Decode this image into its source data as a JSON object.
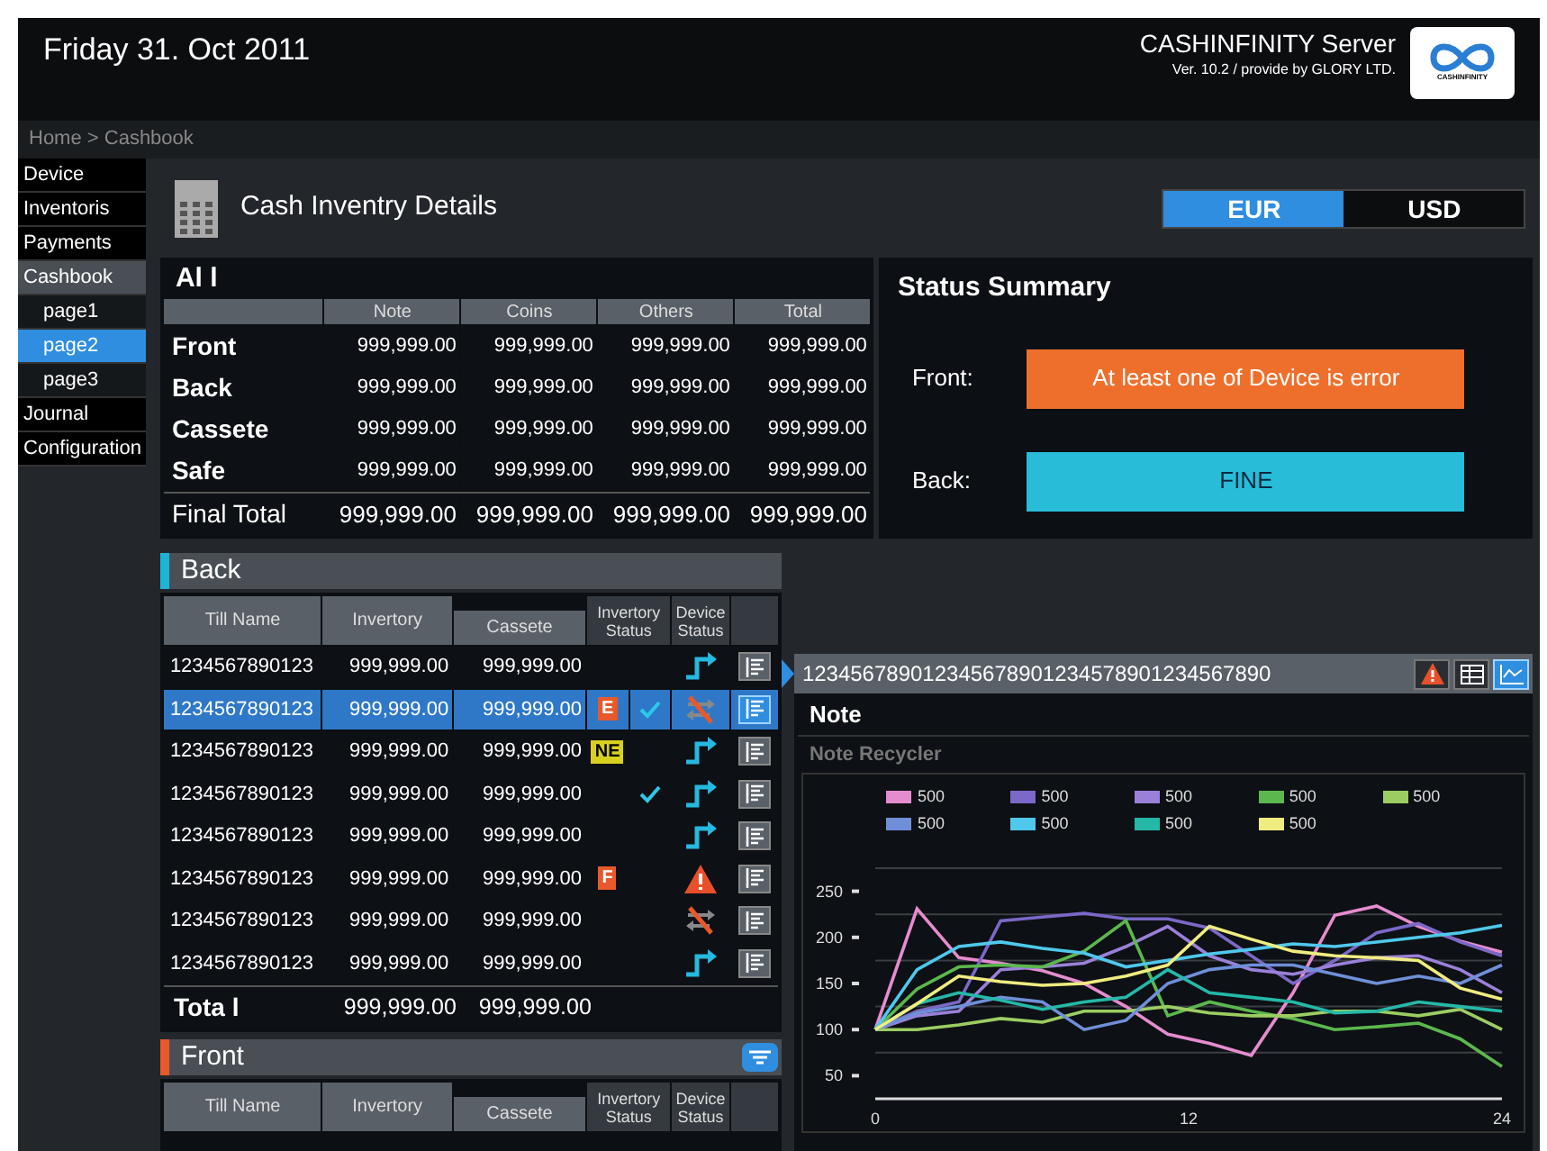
{
  "header": {
    "date": "Friday 31. Oct 2011",
    "product": "CASHINFINITY Server",
    "version": "Ver. 10.2 / provide by GLORY LTD.",
    "logo_text": "CASHINFINITY"
  },
  "breadcrumb": "Home > Cashbook",
  "sidebar": {
    "items": [
      {
        "label": "Device",
        "selected": false
      },
      {
        "label": "Inventoris",
        "selected": false
      },
      {
        "label": "Payments",
        "selected": false
      },
      {
        "label": "Cashbook",
        "selected": false,
        "expanded": true,
        "children": [
          {
            "label": "page1",
            "selected": false
          },
          {
            "label": "page2",
            "selected": true
          },
          {
            "label": "page3",
            "selected": false
          }
        ]
      },
      {
        "label": "Journal",
        "selected": false
      },
      {
        "label": "Configuration",
        "selected": false
      }
    ]
  },
  "page_title": "Cash Inventry Details",
  "currency_tabs": [
    {
      "label": "EUR",
      "selected": true
    },
    {
      "label": "USD",
      "selected": false
    }
  ],
  "all_table": {
    "title": "Al l",
    "columns": [
      "Note",
      "Coins",
      "Others",
      "Total"
    ],
    "rows": [
      {
        "label": "Front",
        "cells": [
          "999,999.00",
          "999,999.00",
          "999,999.00",
          "999,999.00"
        ]
      },
      {
        "label": "Back",
        "cells": [
          "999,999.00",
          "999,999.00",
          "999,999.00",
          "999,999.00"
        ]
      },
      {
        "label": "Cassete",
        "cells": [
          "999,999.00",
          "999,999.00",
          "999,999.00",
          "999,999.00"
        ]
      },
      {
        "label": "Safe",
        "cells": [
          "999,999.00",
          "999,999.00",
          "999,999.00",
          "999,999.00"
        ]
      }
    ],
    "total": {
      "label": "Final Total",
      "cells": [
        "999,999.00",
        "999,999.00",
        "999,999.00",
        "999,999.00"
      ]
    }
  },
  "status_summary": {
    "title": "Status Summary",
    "items": [
      {
        "label": "Front:",
        "status": "At least one of Device is error",
        "kind": "error"
      },
      {
        "label": "Back:",
        "status": "FINE",
        "kind": "fine"
      }
    ]
  },
  "back_table": {
    "title": "Back",
    "color": "#1eb4d8",
    "columns": [
      "Till Name",
      "Invertory",
      "Cassete",
      "Invertory Status",
      "Device Status"
    ],
    "rows": [
      {
        "till": "1234567890123",
        "inventory": "999,999.00",
        "cassete": "999,999.00",
        "checked": false,
        "kind": "connected",
        "selected": false
      },
      {
        "till": "1234567890123",
        "inventory": "999,999.00",
        "cassete": "999,999.00",
        "badge": "E",
        "checked": true,
        "kind": "disconnected",
        "selected": true
      },
      {
        "till": "1234567890123",
        "inventory": "999,999.00",
        "cassete": "999,999.00",
        "badge": "NE",
        "checked": false,
        "kind": "connected",
        "selected": false
      },
      {
        "till": "1234567890123",
        "inventory": "999,999.00",
        "cassete": "999,999.00",
        "checked": true,
        "kind": "connected",
        "selected": false
      },
      {
        "till": "1234567890123",
        "inventory": "999,999.00",
        "cassete": "999,999.00",
        "checked": false,
        "kind": "connected",
        "selected": false
      },
      {
        "till": "1234567890123",
        "inventory": "999,999.00",
        "cassete": "999,999.00",
        "badge": "F",
        "checked": false,
        "kind": "warning",
        "selected": false
      },
      {
        "till": "1234567890123",
        "inventory": "999,999.00",
        "cassete": "999,999.00",
        "checked": false,
        "kind": "disconnected",
        "selected": false
      },
      {
        "till": "1234567890123",
        "inventory": "999,999.00",
        "cassete": "999,999.00",
        "checked": false,
        "kind": "connected",
        "selected": false
      }
    ],
    "total": {
      "label": "Tota l",
      "inventory": "999,999.00",
      "cassete": "999,999.00"
    }
  },
  "front_table": {
    "title": "Front",
    "color": "#e8582a",
    "columns": [
      "Till Name",
      "Invertory",
      "Cassete",
      "Invertory Status",
      "Device Status"
    ]
  },
  "detail": {
    "id": "123456789012345678901234578901234567890",
    "view_buttons": [
      {
        "kind": "warning",
        "selected": false
      },
      {
        "kind": "table",
        "selected": false
      },
      {
        "kind": "chart",
        "selected": true
      }
    ],
    "title": "Note",
    "subtitle": "Note Recycler",
    "chart_data": {
      "type": "line",
      "x": [
        0,
        1.6,
        3.2,
        4.8,
        6.4,
        8,
        9.6,
        11.2,
        12.8,
        14.4,
        16,
        17.6,
        19.2,
        20.8,
        22.4,
        24
      ],
      "xlim": [
        0,
        24
      ],
      "ylim": [
        25,
        275
      ],
      "xticks": [
        0,
        12,
        24
      ],
      "yticks": [
        50,
        100,
        150,
        200,
        250
      ],
      "series": [
        {
          "name": "500",
          "color": "#e58ccf",
          "values": [
            100,
            231,
            178,
            172,
            164,
            150,
            125,
            95,
            85,
            72,
            140,
            224,
            234,
            212,
            196,
            184
          ]
        },
        {
          "name": "500",
          "color": "#7b68c8",
          "values": [
            100,
            120,
            130,
            218,
            222,
            226,
            220,
            220,
            210,
            180,
            150,
            175,
            205,
            215,
            195,
            180
          ]
        },
        {
          "name": "500",
          "color": "#9a80d8",
          "values": [
            100,
            115,
            120,
            165,
            168,
            172,
            190,
            212,
            180,
            165,
            160,
            170,
            178,
            180,
            165,
            140
          ]
        },
        {
          "name": "500",
          "color": "#5cb84e",
          "values": [
            100,
            144,
            168,
            170,
            168,
            185,
            218,
            115,
            130,
            120,
            112,
            100,
            103,
            107,
            90,
            60
          ]
        },
        {
          "name": "500",
          "color": "#9ccd62",
          "values": [
            100,
            100,
            105,
            112,
            108,
            120,
            120,
            125,
            118,
            115,
            115,
            120,
            120,
            115,
            122,
            100
          ]
        },
        {
          "name": "500",
          "color": "#6f8fd8",
          "values": [
            100,
            118,
            125,
            135,
            130,
            100,
            110,
            150,
            165,
            170,
            170,
            160,
            150,
            158,
            150,
            170
          ]
        },
        {
          "name": "500",
          "color": "#4fc8ec",
          "values": [
            100,
            165,
            190,
            195,
            188,
            183,
            168,
            175,
            182,
            187,
            193,
            190,
            195,
            200,
            205,
            213
          ]
        },
        {
          "name": "500",
          "color": "#25b8a8",
          "values": [
            100,
            128,
            140,
            132,
            122,
            130,
            135,
            165,
            140,
            135,
            130,
            118,
            120,
            130,
            125,
            120
          ]
        },
        {
          "name": "500",
          "color": "#f0ec80",
          "values": [
            100,
            128,
            158,
            152,
            148,
            150,
            158,
            170,
            212,
            198,
            185,
            180,
            178,
            175,
            145,
            133
          ]
        }
      ]
    }
  }
}
